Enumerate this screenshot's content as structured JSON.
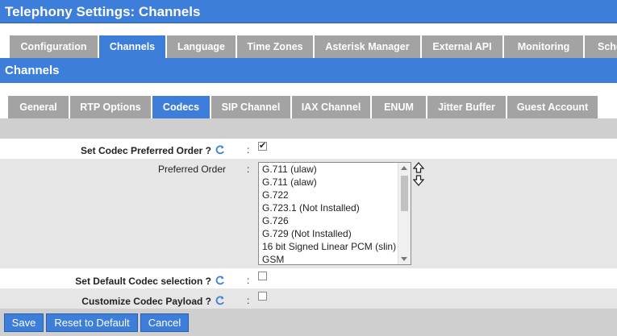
{
  "page": {
    "title": "Telephony Settings:  Channels"
  },
  "main_tabs": [
    {
      "label": "Configuration",
      "active": false
    },
    {
      "label": "Channels",
      "active": true
    },
    {
      "label": "Language",
      "active": false
    },
    {
      "label": "Time Zones",
      "active": false
    },
    {
      "label": "Asterisk Manager",
      "active": false
    },
    {
      "label": "External API",
      "active": false
    },
    {
      "label": "Monitoring",
      "active": false
    },
    {
      "label": "Sche",
      "active": false
    }
  ],
  "section": {
    "title": "Channels"
  },
  "sub_tabs": [
    {
      "label": "General",
      "active": false
    },
    {
      "label": "RTP Options",
      "active": false
    },
    {
      "label": "Codecs",
      "active": true
    },
    {
      "label": "SIP Channel",
      "active": false
    },
    {
      "label": "IAX Channel",
      "active": false
    },
    {
      "label": "ENUM",
      "active": false
    },
    {
      "label": "Jitter Buffer",
      "active": false
    },
    {
      "label": "Guest Account",
      "active": false
    }
  ],
  "form": {
    "set_codec_order": {
      "label": "Set Codec Preferred Order ?",
      "colon": ":",
      "checked": true
    },
    "preferred_order": {
      "label": "Preferred Order",
      "colon": ":",
      "options": [
        "G.711 (ulaw)",
        "G.711 (alaw)",
        "G.722",
        "G.723.1 (Not Installed)",
        "G.726",
        "G.729 (Not Installed)",
        "16 bit Signed Linear PCM (slin)",
        "GSM"
      ]
    },
    "default_codec": {
      "label": "Set Default Codec selection ?",
      "colon": ":",
      "checked": false
    },
    "customize_payload": {
      "label": "Customize Codec Payload ?",
      "colon": ":",
      "checked": false
    }
  },
  "buttons": {
    "save": "Save",
    "reset": "Reset to Default",
    "cancel": "Cancel"
  },
  "colors": {
    "accent": "#3d7edb",
    "tab_inactive": "#a3a3a3",
    "row_alt": "#e6e6e6",
    "footer": "#cfcfcf"
  },
  "icons": {
    "help": "refresh-help-icon",
    "order": "up-down-arrows-icon"
  }
}
